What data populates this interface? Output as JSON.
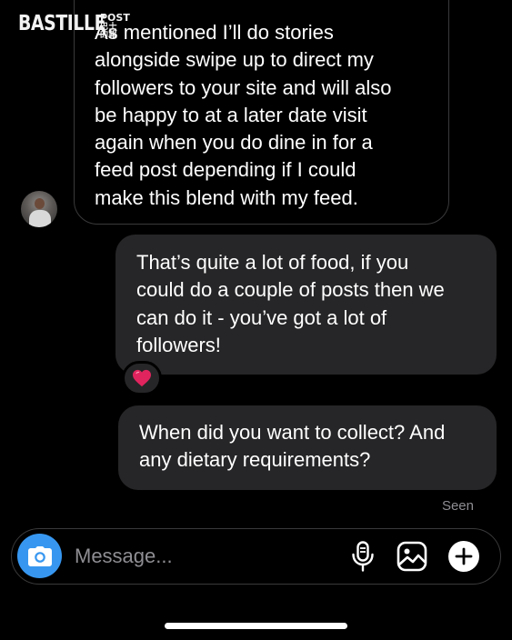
{
  "watermark": {
    "main": "BASTILLE",
    "side_top": "POST",
    "side_bottom": "巴士的報"
  },
  "messages": [
    {
      "direction": "received",
      "text": "As mentioned I’ll do stories\nalongside swipe up to direct my\nfollowers to your site and will also\nbe happy to at a later date visit\nagain when you do dine in for a\nfeed post depending if I could\nmake this blend with my feed."
    },
    {
      "direction": "sent",
      "text": "That’s quite a lot of food, if you\ncould do a couple of posts then we\ncan do it - you’ve got a lot of\nfollowers!",
      "reaction": "heart"
    },
    {
      "direction": "sent",
      "text": "When did you want to collect? And\nany dietary requirements?"
    }
  ],
  "status": {
    "seen": "Seen"
  },
  "composer": {
    "placeholder": "Message...",
    "value": "",
    "icons": [
      "camera-icon",
      "microphone-icon",
      "gallery-icon",
      "plus-icon"
    ]
  },
  "colors": {
    "background": "#000000",
    "sent_bubble": "#262628",
    "received_border": "#3a3a3c",
    "camera_button": "#3797f0",
    "reaction_heart": "#e0245e",
    "muted_text": "#8e8e93"
  }
}
